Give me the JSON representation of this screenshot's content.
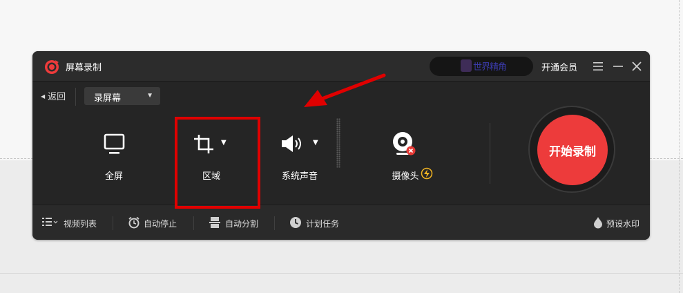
{
  "window": {
    "title": "屏幕录制",
    "user_name": "世界精角",
    "vip_label": "开通会员"
  },
  "toolbar": {
    "back_label": "返回",
    "mode_value": "录屏幕"
  },
  "sources": {
    "fullscreen": "全屏",
    "region": "区域",
    "system_audio": "系统声音",
    "camera": "摄像头"
  },
  "record_button": "开始录制",
  "bottom": {
    "video_list": "视频列表",
    "auto_stop": "自动停止",
    "auto_split": "自动分割",
    "scheduled_task": "计划任务",
    "watermark": "预设水印"
  },
  "colors": {
    "record": "#ed3b3b",
    "annotation": "#e00000",
    "badge": "#f0b322"
  },
  "icons": [
    "logo-icon",
    "menu-icon",
    "minimize-icon",
    "close-icon",
    "monitor-icon",
    "crop-icon",
    "speaker-icon",
    "webcam-icon",
    "lightning-icon",
    "list-icon",
    "alarm-clock-icon",
    "split-icon",
    "clock-icon",
    "droplet-icon",
    "arrow-annotation"
  ]
}
